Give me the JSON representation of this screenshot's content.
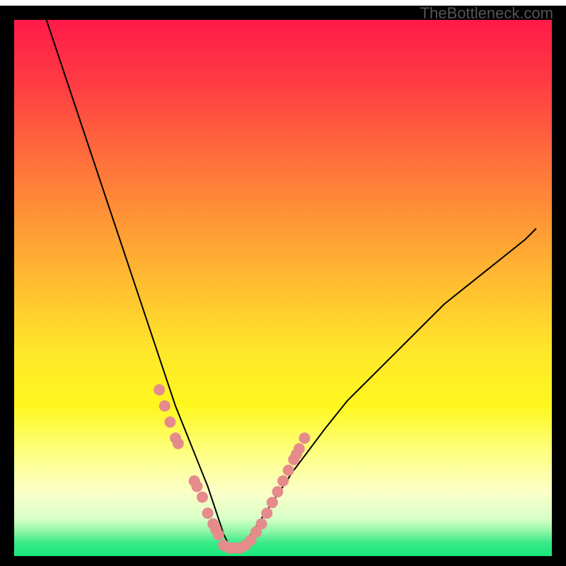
{
  "watermark": "TheBottleneck.com",
  "chart_data": {
    "type": "line",
    "title": "",
    "xlabel": "",
    "ylabel": "",
    "xlim": [
      0,
      100
    ],
    "ylim": [
      0,
      100
    ],
    "background": {
      "type": "vertical_gradient",
      "stops": [
        {
          "offset": 0.0,
          "color": "#ff1a48"
        },
        {
          "offset": 0.125,
          "color": "#ff3e42"
        },
        {
          "offset": 0.25,
          "color": "#ff6c3c"
        },
        {
          "offset": 0.375,
          "color": "#ff9636"
        },
        {
          "offset": 0.5,
          "color": "#ffc030"
        },
        {
          "offset": 0.625,
          "color": "#ffe82a"
        },
        {
          "offset": 0.72,
          "color": "#fff71e"
        },
        {
          "offset": 0.8,
          "color": "#fdff7a"
        },
        {
          "offset": 0.88,
          "color": "#fcffc8"
        },
        {
          "offset": 0.93,
          "color": "#d8ffc8"
        },
        {
          "offset": 0.955,
          "color": "#8af5a3"
        },
        {
          "offset": 0.975,
          "color": "#3be989"
        },
        {
          "offset": 1.0,
          "color": "#17e879"
        }
      ]
    },
    "frame_color": "#000000",
    "frame_width": 2.5,
    "series": [
      {
        "name": "bottleneck_curve",
        "color": "#000000",
        "width": 2,
        "x": [
          6,
          8,
          10,
          12,
          14,
          16,
          18,
          20,
          22,
          24,
          26,
          28,
          30,
          32,
          34,
          36,
          37,
          38,
          39,
          40,
          41,
          42,
          43,
          44,
          46,
          48,
          50,
          52,
          55,
          58,
          62,
          66,
          70,
          75,
          80,
          85,
          90,
          95,
          97
        ],
        "y": [
          100,
          94,
          88,
          82,
          76,
          70,
          64,
          58,
          52,
          46,
          40,
          34,
          28,
          23,
          18,
          13,
          10,
          7,
          4,
          2,
          2,
          2,
          3,
          4,
          7,
          10,
          13,
          16,
          20,
          24,
          29,
          33,
          37,
          42,
          47,
          51,
          55,
          59,
          61
        ]
      }
    ],
    "markers": {
      "name": "highlight_beads",
      "color": "#e58b8b",
      "radius": 8,
      "x": [
        27,
        28,
        29,
        30,
        30.5,
        33.5,
        34,
        35,
        36,
        37,
        37.5,
        38,
        39,
        40,
        41,
        42,
        43,
        44,
        45,
        46,
        47,
        48,
        49,
        50,
        51,
        52,
        52.5,
        53,
        54
      ],
      "y": [
        31,
        28,
        25,
        22,
        21,
        14,
        13,
        11,
        8,
        6,
        5,
        4,
        2,
        1.5,
        1.5,
        1.5,
        2,
        3,
        4.5,
        6,
        8,
        10,
        12,
        14,
        16,
        18,
        19,
        20,
        22
      ]
    }
  }
}
